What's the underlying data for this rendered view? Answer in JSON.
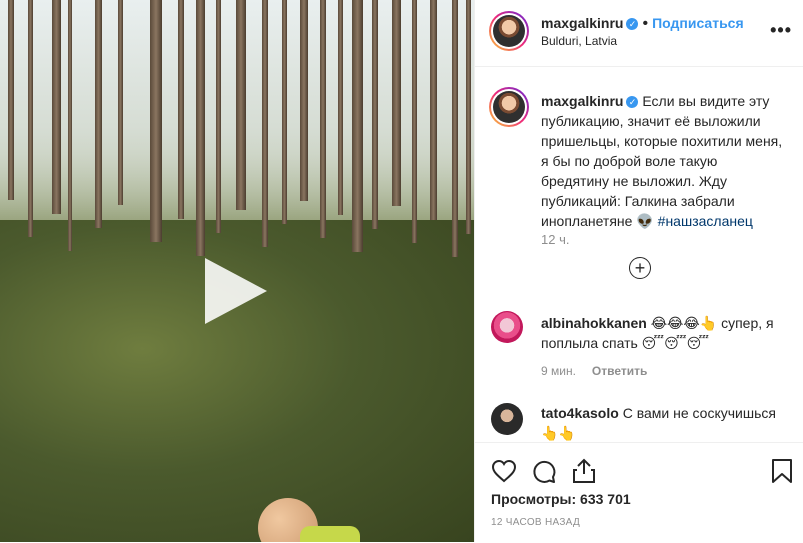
{
  "post": {
    "username": "maxgalkinru",
    "verified_mark": "✓",
    "dot": "•",
    "follow_label": "Подписаться",
    "location": "Bulduri, Latvia",
    "more_label": "•••"
  },
  "caption": {
    "username": "maxgalkinru",
    "text": " Если вы видите эту публикацию, значит её выложили пришельцы, которые похитили меня, я бы по доброй воле такую бредятину не выложил. Жду публикаций: Галкина забрали инопланетяне 👽 ",
    "hashtag": "#нашзасланец",
    "time": "12 ч."
  },
  "load_more_icon": "plus-circle-icon",
  "comments": [
    {
      "username": "albinahokkanen",
      "text": " 😂😂😂👆 супер, я поплыла спать 😴😴😴",
      "time": "9 мин.",
      "reply_label": "Ответить"
    },
    {
      "username": "tato4kasolo",
      "text": " С вами не соскучишься 👆👆"
    }
  ],
  "actions": {
    "like_icon": "heart-icon",
    "comment_icon": "comment-icon",
    "share_icon": "share-icon",
    "save_icon": "bookmark-icon"
  },
  "stats": {
    "views_label": "Просмотры:",
    "views_count": " 633 701",
    "posted_ago": "12 ЧАСОВ НАЗАД"
  },
  "colors": {
    "link": "#3897f0",
    "hashtag": "#00376b",
    "muted": "#8e8e8e"
  }
}
